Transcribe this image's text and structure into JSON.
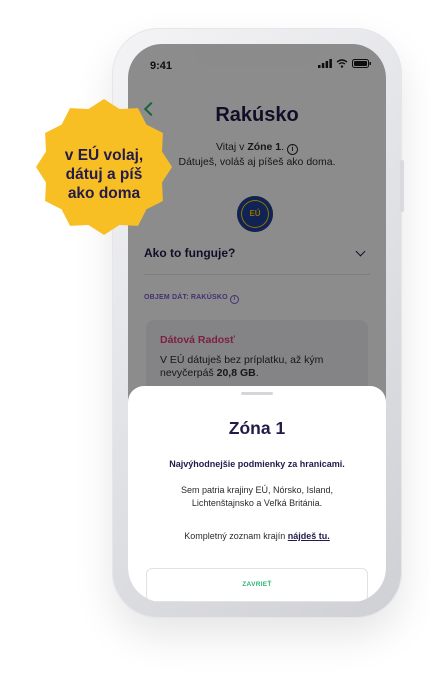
{
  "status_bar": {
    "time": "9:41"
  },
  "header": {
    "title": "Rakúsko",
    "welcome_prefix": "Vitaj v ",
    "zone": "Zóne 1",
    "welcome_suffix": ".",
    "welcome_line2": "Dátuješ, voláš aj píšeš ako doma."
  },
  "eu_flag": {
    "label": "EÚ"
  },
  "accordion": {
    "label": "Ako to funguje?"
  },
  "data_section": {
    "label": "OBJEM DÁT: RAKÚSKO",
    "card_title": "Dátová Radosť",
    "card_text_prefix": "V EÚ dátuješ bez príplatku, až kým nevyčerpáš ",
    "card_text_amount": "20,8 GB",
    "card_text_suffix": "."
  },
  "sheet": {
    "title": "Zóna 1",
    "subtitle": "Najvýhodnejšie podmienky za hranicami.",
    "body": "Sem patria krajiny EÚ, Nórsko, Island, Lichtenštajnsko a Veľká Británia.",
    "link_prefix": "Kompletný zoznam krajín ",
    "link_text": "nájdeš tu.",
    "close_label": "ZAVRIEŤ"
  },
  "badge": {
    "line1": "v EÚ volaj,",
    "line2": "dátuj a píš",
    "line3": "ako doma"
  },
  "colors": {
    "accent_green": "#2bb673",
    "brand_navy": "#241b4a",
    "badge_yellow": "#f7bf23",
    "section_purple": "#7a5ad3",
    "card_title_pink": "#e23b73",
    "eu_blue": "#1f3f9a"
  }
}
